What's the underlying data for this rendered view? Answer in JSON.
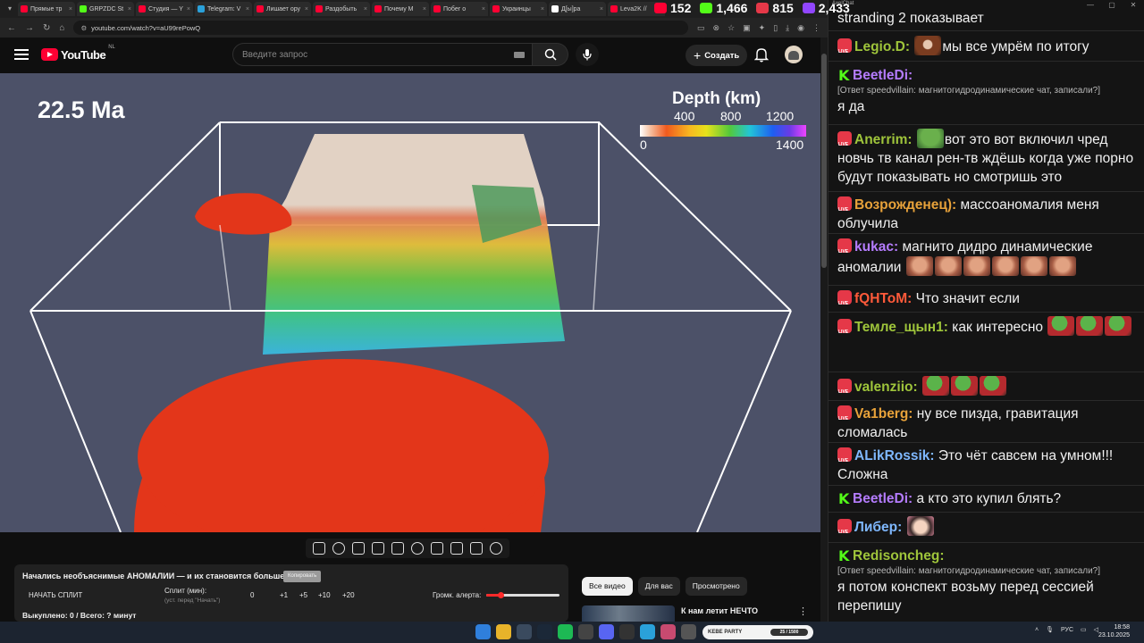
{
  "browser": {
    "tabs": [
      {
        "label": "Прямые тр",
        "color": "#ff0033"
      },
      {
        "label": "GRPZDC St",
        "color": "#53fc18"
      },
      {
        "label": "Студия — Y",
        "color": "#ff0033"
      },
      {
        "label": "Telegram: V",
        "color": "#2aa1da"
      },
      {
        "label": "Лишает ору",
        "color": "#ff0033"
      },
      {
        "label": "Раздобыть",
        "color": "#ff0033"
      },
      {
        "label": "Почему М",
        "color": "#ff0033"
      },
      {
        "label": "Побег о",
        "color": "#ff0033"
      },
      {
        "label": "Украинцы",
        "color": "#ff0033"
      },
      {
        "label": "Д[ы]ра",
        "color": "#ffffff"
      },
      {
        "label": "Leva2K //",
        "color": "#ff0033"
      }
    ],
    "url": "youtube.com/watch?v=aU99rePowQ"
  },
  "counters": [
    {
      "value": "152",
      "icon": "youtube-live-icon",
      "color": "#ff0033"
    },
    {
      "value": "1,466",
      "icon": "kick-icon",
      "color": "#53fc18"
    },
    {
      "value": "815",
      "icon": "vk-live-icon",
      "color": "#e53848"
    },
    {
      "value": "2,433",
      "icon": "twitch-icon",
      "color": "#9146ff"
    }
  ],
  "youtube": {
    "logo_text": "YouTube",
    "region": "NL",
    "search_placeholder": "Введите запрос",
    "create_label": "Создать"
  },
  "video": {
    "time_label": "22.5 Ma",
    "depth_title": "Depth (km)",
    "ticks_top": [
      "400",
      "800",
      "1200"
    ],
    "ticks_bottom": [
      "0",
      "1400"
    ]
  },
  "split": {
    "title": "Начались необъяснимые АНОМАЛИИ — и их становится больше.",
    "badge": "Копировать",
    "start_label": "НАЧАТЬ СПЛИТ",
    "minutes_label": "Сплит (мин):",
    "minutes_hint": "(уст. перед \"Начать\")",
    "buttons": [
      "0",
      "+1",
      "+5",
      "+10",
      "+20"
    ],
    "alert_label": "Громк. алерта:",
    "alert_level": 0.2,
    "bought_label": "Выкуплено: 0 / Всего: ? минут"
  },
  "chips": [
    "Все видео",
    "Для вас",
    "Просмотрено"
  ],
  "recommendation": {
    "title": "К нам летит НЕЧТО"
  },
  "chat": {
    "window_title": "AxelChat",
    "messages": [
      {
        "platform": "none",
        "user": "",
        "color": "#ffffff",
        "text": "stranding 2 показывает",
        "emotes": []
      },
      {
        "platform": "live",
        "user": "Legio.D:",
        "color": "#9fc53b",
        "text": "мы все умрём по итогу",
        "emotes": [
          "brown"
        ]
      },
      {
        "platform": "kick",
        "user": "BeetleDi:",
        "color": "#b57cff",
        "reply": "[Ответ speedvillain: магнитогидродинамические чат, записали?]",
        "text": "я да",
        "emotes": []
      },
      {
        "platform": "live",
        "user": "Anerrim:",
        "color": "#9fc53b",
        "text": "вот это вот включил чред новчь тв канал рен-тв ждёшь когда уже порно будут показывать но смотришь это",
        "emotes": [
          "pepe"
        ]
      },
      {
        "platform": "live",
        "user": "Возрожденец):",
        "color": "#e8a23a",
        "text": "массоаномалия меня облучила",
        "emotes": []
      },
      {
        "platform": "live",
        "user": "kukac:",
        "color": "#b57cff",
        "text": "магнито дидро динамические аномалии",
        "emotes": [
          "face",
          "face",
          "face",
          "face",
          "face",
          "face"
        ]
      },
      {
        "platform": "live",
        "user": "fQHToM:",
        "color": "#ff5a3a",
        "text": "Что значит если",
        "emotes": []
      },
      {
        "platform": "live",
        "user": "Темле_щын1:",
        "color": "#9fc53b",
        "text": "как интересно",
        "emotes": [
          "frog",
          "frog",
          "frog"
        ]
      },
      {
        "platform": "live",
        "user": "valenziio:",
        "color": "#9fc53b",
        "text": "",
        "emotes": [
          "frog",
          "frog",
          "frog"
        ]
      },
      {
        "platform": "live",
        "user": "Va1berg:",
        "color": "#e8a23a",
        "text": "ну все пизда, гравитация сломалась",
        "emotes": []
      },
      {
        "platform": "live",
        "user": "ALikRossik:",
        "color": "#7fb8ff",
        "text": "Это чёт савсем на умном!!! Сложна",
        "emotes": []
      },
      {
        "platform": "kick",
        "user": "BeetleDi:",
        "color": "#b57cff",
        "text": "а кто это купил блять?",
        "emotes": []
      },
      {
        "platform": "live",
        "user": "Либер:",
        "color": "#7fb8ff",
        "text": "",
        "emotes": [
          "anime"
        ]
      },
      {
        "platform": "kick",
        "user": "Redisoncheg:",
        "color": "#9fc53b",
        "reply": "[Ответ speedvillain: магнитогидродинамические чат, записали?]",
        "text": "я потом конспект возьму перед сессией перепишу",
        "emotes": []
      }
    ]
  },
  "taskbar": {
    "kebe_label": "KEBE PARTY",
    "kebe_progress": "25 / 1500",
    "lang": "РУС",
    "time": "18:58",
    "date": "23.10.2025"
  }
}
